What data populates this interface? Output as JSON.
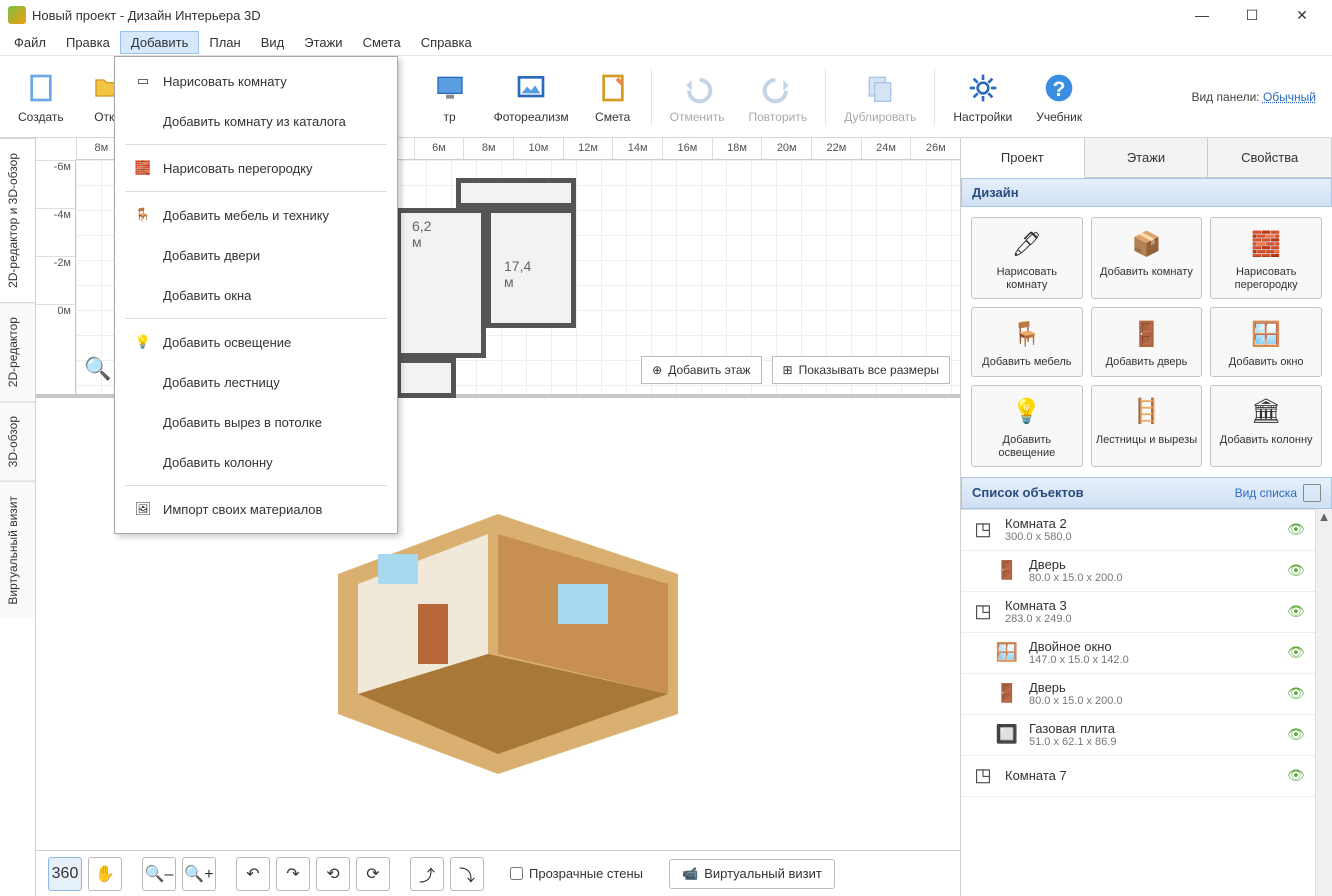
{
  "title": "Новый проект - Дизайн Интерьера 3D",
  "menu": [
    "Файл",
    "Правка",
    "Добавить",
    "План",
    "Вид",
    "Этажи",
    "Смета",
    "Справка"
  ],
  "menu_active_index": 2,
  "dropdown": {
    "groups": [
      [
        "Нарисовать комнату",
        "Добавить комнату из каталога"
      ],
      [
        "Нарисовать перегородку"
      ],
      [
        "Добавить мебель и технику",
        "Добавить двери",
        "Добавить окна"
      ],
      [
        "Добавить освещение",
        "Добавить лестницу",
        "Добавить вырез в потолке",
        "Добавить колонну"
      ],
      [
        "Импорт своих материалов"
      ]
    ]
  },
  "toolbar": [
    {
      "label": "Создать",
      "icon": "file",
      "disabled": false
    },
    {
      "label": "Открыть",
      "icon": "folder",
      "disabled": false,
      "truncated": "Откр"
    },
    {
      "label": "тр",
      "icon": "monitor",
      "disabled": false
    },
    {
      "label": "Фотореализм",
      "icon": "photo",
      "disabled": false
    },
    {
      "label": "Смета",
      "icon": "clipboard",
      "disabled": false
    },
    {
      "label": "Отменить",
      "icon": "undo",
      "disabled": true
    },
    {
      "label": "Повторить",
      "icon": "redo",
      "disabled": true
    },
    {
      "label": "Дублировать",
      "icon": "dup",
      "disabled": true
    },
    {
      "label": "Настройки",
      "icon": "gear",
      "disabled": false
    },
    {
      "label": "Учебник",
      "icon": "help",
      "disabled": false
    }
  ],
  "panel_view": {
    "label": "Вид панели:",
    "link": "Обычный"
  },
  "side_tabs": [
    "2D-редактор и 3D-обзор",
    "2D-редактор",
    "3D-обзор",
    "Виртуальный визит"
  ],
  "side_tab_active": 0,
  "ruler_h": [
    "8м",
    "6м",
    "8м",
    "10м",
    "12м",
    "14м",
    "16м",
    "18м",
    "20м",
    "22м",
    "24м",
    "26м"
  ],
  "ruler_v": [
    "-6м",
    "-4м",
    "-2м",
    "0м"
  ],
  "floor_labels": {
    "room1": "6,2 м",
    "room2": "17,4 м"
  },
  "floor_buttons": {
    "add": "Добавить этаж",
    "show": "Показывать все размеры"
  },
  "bottom": {
    "transparent": "Прозрачные стены",
    "virtual": "Виртуальный визит"
  },
  "right_tabs": [
    "Проект",
    "Этажи",
    "Свойства"
  ],
  "right_tab_active": 0,
  "design_header": "Дизайн",
  "design_buttons": [
    "Нарисовать комнату",
    "Добавить комнату",
    "Нарисовать перегородку",
    "Добавить мебель",
    "Добавить дверь",
    "Добавить окно",
    "Добавить освещение",
    "Лестницы и вырезы",
    "Добавить колонну"
  ],
  "objects_header": {
    "title": "Список объектов",
    "view": "Вид списка"
  },
  "objects": [
    {
      "name": "Комната 2",
      "dim": "300.0 x 580.0",
      "icon": "room",
      "child": false
    },
    {
      "name": "Дверь",
      "dim": "80.0 x 15.0 x 200.0",
      "icon": "door",
      "child": true
    },
    {
      "name": "Комната 3",
      "dim": "283.0 x 249.0",
      "icon": "room",
      "child": false
    },
    {
      "name": "Двойное окно",
      "dim": "147.0 x 15.0 x 142.0",
      "icon": "window",
      "child": true
    },
    {
      "name": "Дверь",
      "dim": "80.0 x 15.0 x 200.0",
      "icon": "door",
      "child": true
    },
    {
      "name": "Газовая плита",
      "dim": "51.0 x 62.1 x 86.9",
      "icon": "stove",
      "child": true
    },
    {
      "name": "Комната 7",
      "dim": "",
      "icon": "room",
      "child": false
    }
  ]
}
